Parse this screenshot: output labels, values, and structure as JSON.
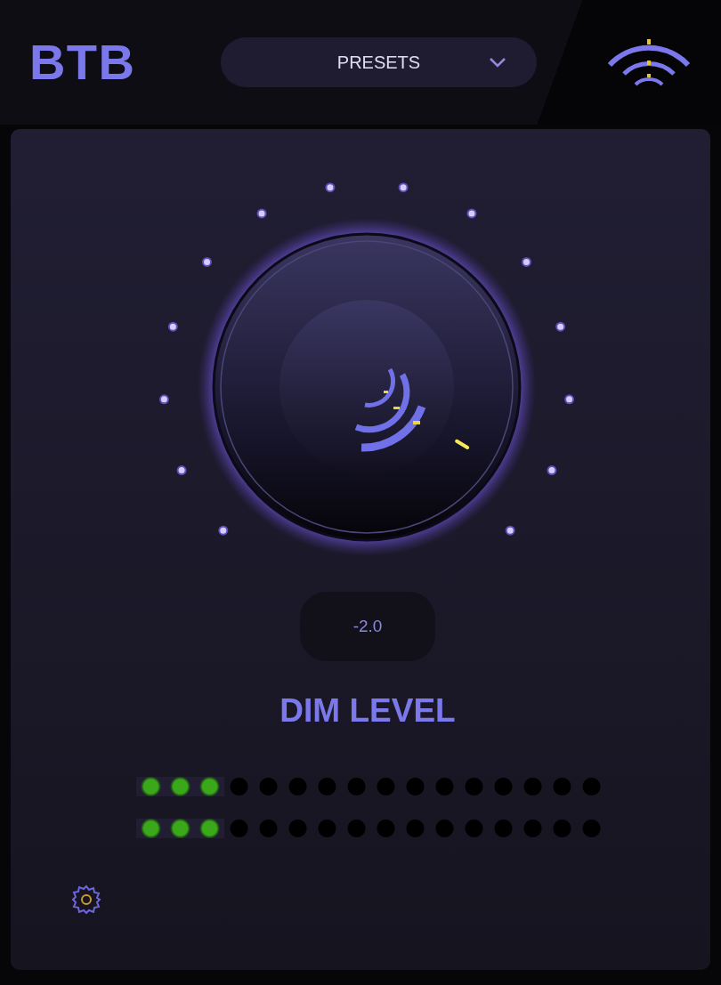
{
  "header": {
    "logo": "BTB",
    "presets": {
      "label": "PRESETS"
    }
  },
  "knob": {
    "value": "-2.0",
    "label": "DIM LEVEL"
  },
  "meters": [
    {
      "level": 0.1875
    },
    {
      "level": 0.1875
    }
  ]
}
